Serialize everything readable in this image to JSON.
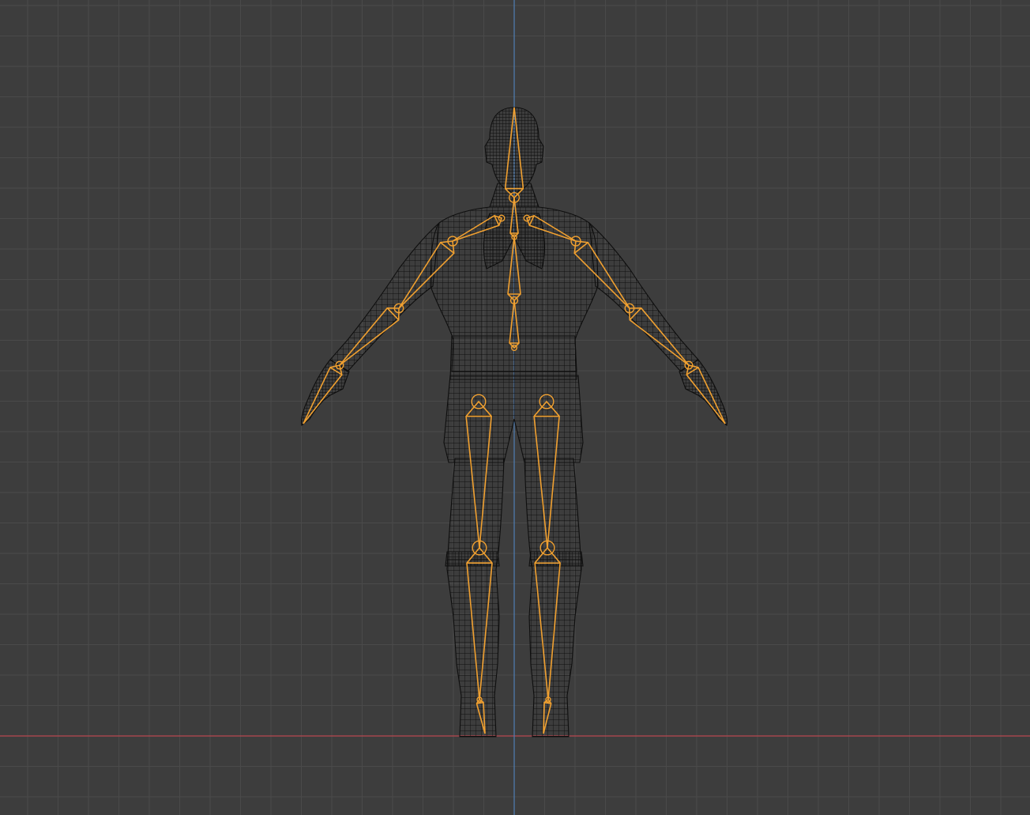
{
  "viewport": {
    "name": "3d-viewport",
    "view": "front-orthographic",
    "shading": "wireframe",
    "colors": {
      "background": "#3d3d3d",
      "grid_minor": "#4a4a4a",
      "grid_major": "#545454",
      "x_axis": "#b8474f",
      "z_axis": "#4f7fb5",
      "mesh_wire": "#0e0e0e",
      "bone_selected": "#f0a030",
      "bone_dark": "#7a4b12"
    }
  },
  "scene_objects": [
    {
      "name": "character-mesh",
      "type": "mesh",
      "display": "wireframe"
    },
    {
      "name": "armature",
      "type": "armature",
      "display": "octahedral",
      "selected": true
    }
  ]
}
